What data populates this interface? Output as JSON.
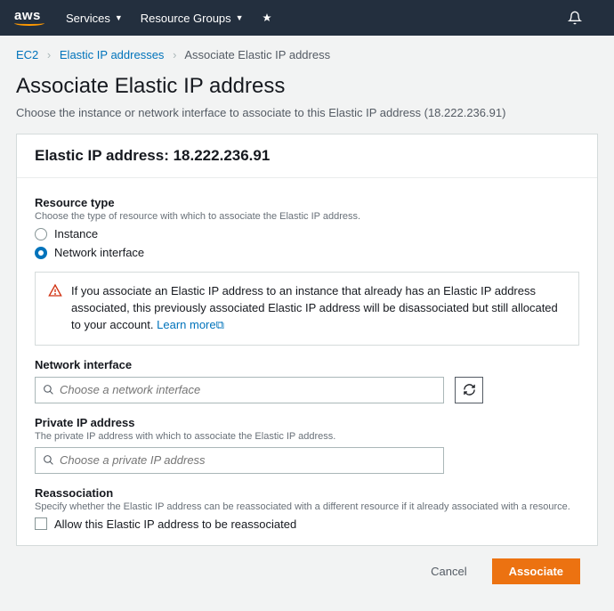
{
  "nav": {
    "logo": "aws",
    "services": "Services",
    "resource_groups": "Resource Groups"
  },
  "breadcrumb": {
    "ec2": "EC2",
    "eip": "Elastic IP addresses",
    "current": "Associate Elastic IP address"
  },
  "page": {
    "title": "Associate Elastic IP address",
    "desc": "Choose the instance or network interface to associate to this Elastic IP address (18.222.236.91)"
  },
  "panel": {
    "header": "Elastic IP address: 18.222.236.91"
  },
  "resource_type": {
    "label": "Resource type",
    "hint": "Choose the type of resource with which to associate the Elastic IP address.",
    "option_instance": "Instance",
    "option_ni": "Network interface"
  },
  "alert": {
    "text": "If you associate an Elastic IP address to an instance that already has an Elastic IP address associated, this previously associated Elastic IP address will be disassociated but still allocated to your account. ",
    "learn_more": "Learn more"
  },
  "network_interface": {
    "label": "Network interface",
    "placeholder": "Choose a network interface"
  },
  "private_ip": {
    "label": "Private IP address",
    "hint": "The private IP address with which to associate the Elastic IP address.",
    "placeholder": "Choose a private IP address"
  },
  "reassociation": {
    "label": "Reassociation",
    "hint": "Specify whether the Elastic IP address can be reassociated with a different resource if it already associated with a resource.",
    "checkbox": "Allow this Elastic IP address to be reassociated"
  },
  "buttons": {
    "cancel": "Cancel",
    "associate": "Associate"
  }
}
